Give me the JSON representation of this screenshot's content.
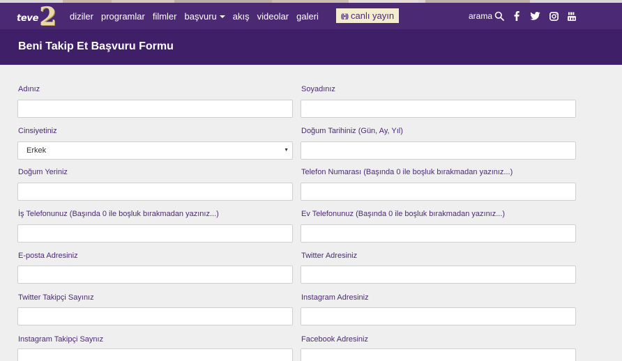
{
  "brand": {
    "word": "teve",
    "number": "2"
  },
  "nav": {
    "items": [
      {
        "label": "diziler"
      },
      {
        "label": "programlar"
      },
      {
        "label": "filmler"
      },
      {
        "label": "başvuru"
      },
      {
        "label": "akış"
      },
      {
        "label": "videolar"
      },
      {
        "label": "galeri"
      }
    ],
    "live_label": "canlı yayın",
    "search_label": "arama"
  },
  "page": {
    "title": "Beni Takip Et Başvuru Formu"
  },
  "form": {
    "fields": [
      {
        "label": "Adınız",
        "value": ""
      },
      {
        "label": "Soyadınız",
        "value": ""
      },
      {
        "label": "Cinsiyetiniz",
        "value": "Erkek"
      },
      {
        "label": "Doğum Tarihiniz (Gün, Ay, Yıl)",
        "value": ""
      },
      {
        "label": "Doğum Yeriniz",
        "value": ""
      },
      {
        "label": "Telefon Numarası (Başında 0 ile boşluk bırakmadan yazınız...)",
        "value": ""
      },
      {
        "label": "İş Telefonunuz (Başında 0 ile boşluk bırakmadan yazınız...)",
        "value": ""
      },
      {
        "label": "Ev Telefonunuz (Başında 0 ile boşluk bırakmadan yazınız...)",
        "value": ""
      },
      {
        "label": "E-posta Adresiniz",
        "value": ""
      },
      {
        "label": "Twitter Adresiniz",
        "value": ""
      },
      {
        "label": "Twitter Takipçi Sayınız",
        "value": ""
      },
      {
        "label": "Instagram Adresiniz",
        "value": ""
      },
      {
        "label": "Instagram Takipçi Saynız",
        "value": ""
      },
      {
        "label": "Facebook Adresiniz",
        "value": ""
      }
    ]
  },
  "colors": {
    "nav_bg": "#4b2a73",
    "title_bar_bg": "#3f1f68",
    "label_text": "#4a2a72",
    "live_button_bg": "#f4eccf",
    "page_bg": "#efefef"
  },
  "icons": {
    "social": [
      "facebook-icon",
      "twitter-icon",
      "instagram-icon",
      "youtube-icon"
    ]
  }
}
